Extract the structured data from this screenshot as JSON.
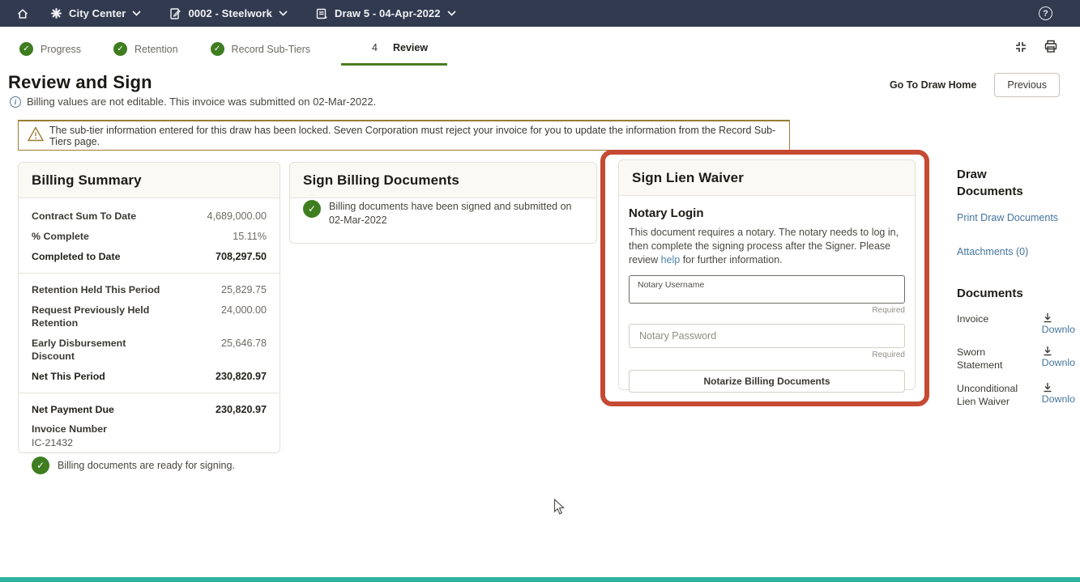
{
  "colors": {
    "topbar_bg": "#323a50",
    "success_green": "#3e7d20",
    "step_underline": "#4c7d24",
    "highlight_red": "#c64a33",
    "warning_border": "#9a7d35",
    "link_blue": "#44759e",
    "bottom_teal": "#2eb3a0"
  },
  "topbar": {
    "project": "City Center",
    "contract": "0002 - Steelwork",
    "draw": "Draw 5 - 04-Apr-2022"
  },
  "stepper": {
    "steps": [
      {
        "label": "Progress"
      },
      {
        "label": "Retention"
      },
      {
        "label": "Record Sub-Tiers"
      },
      {
        "label": "Review",
        "number": "4"
      }
    ]
  },
  "page": {
    "title": "Review and Sign",
    "info": "Billing values are not editable. This invoice was submitted on 02-Mar-2022.",
    "go_home": "Go To Draw Home",
    "previous": "Previous",
    "warning": "The sub-tier information entered for this draw has been locked. Seven Corporation must reject your invoice for you to update the information from the Record Sub-Tiers page."
  },
  "billing_summary": {
    "title": "Billing Summary",
    "rows": [
      {
        "label": "Contract Sum To Date",
        "value": "4,689,000.00"
      },
      {
        "label": "% Complete",
        "value": "15.11%"
      },
      {
        "label": "Completed to Date",
        "value": "708,297.50"
      },
      {
        "label": "Retention Held This Period",
        "value": "25,829.75"
      },
      {
        "label": "Request Previously Held Retention",
        "value": "24,000.00"
      },
      {
        "label": "Early Disbursement Discount",
        "value": "25,646.78"
      },
      {
        "label": "Net This Period",
        "value": "230,820.97"
      },
      {
        "label": "Net Payment Due",
        "value": "230,820.97"
      }
    ],
    "invoice_number_label": "Invoice Number",
    "invoice_number": "IC-21432",
    "ready_note": "Billing documents are ready for signing."
  },
  "sign_billing": {
    "title": "Sign Billing Documents",
    "status": "Billing documents have been signed and submitted on 02-Mar-2022"
  },
  "lien_waiver": {
    "title": "Sign Lien Waiver",
    "notary_heading": "Notary Login",
    "desc_before": "This document requires a notary. The notary needs to log in, then complete the signing process after the Signer. Please review ",
    "help_link": "help",
    "desc_after": " for further information.",
    "username_label": "Notary Username",
    "password_placeholder": "Notary Password",
    "required": "Required",
    "notarize_button": "Notarize Billing Documents"
  },
  "sidebar": {
    "draw_documents_title": "Draw Documents",
    "print_link": "Print Draw Documents",
    "attachments_link": "Attachments (0)",
    "documents_title": "Documents",
    "documents": [
      {
        "name": "Invoice",
        "action": "Downlo"
      },
      {
        "name": "Sworn Statement",
        "action": "Downlo"
      },
      {
        "name": "Unconditional Lien Waiver",
        "action": "Downlo"
      }
    ]
  }
}
